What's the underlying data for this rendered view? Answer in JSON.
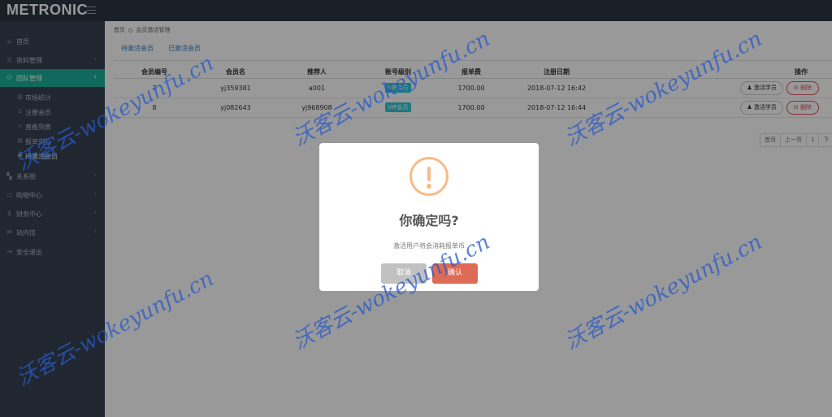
{
  "header": {
    "logo": "METRONIC"
  },
  "sidebar": {
    "items": [
      {
        "label": "首页",
        "icon": "home-icon"
      },
      {
        "label": "资料管理",
        "icon": "user-icon"
      },
      {
        "label": "团队管理",
        "icon": "team-icon",
        "active": true
      },
      {
        "label": "关系图",
        "icon": "sitemap-icon"
      },
      {
        "label": "购物中心",
        "icon": "cart-icon"
      },
      {
        "label": "财务中心",
        "icon": "dollar-icon"
      },
      {
        "label": "站内信",
        "icon": "mail-icon"
      },
      {
        "label": "安全退出",
        "icon": "logout-icon"
      }
    ],
    "subitems": [
      {
        "label": "市场统计",
        "icon": "chart-icon"
      },
      {
        "label": "注册会员",
        "icon": "user-add-icon"
      },
      {
        "label": "直推列表",
        "icon": "share-icon"
      },
      {
        "label": "报单中心",
        "icon": "doc-icon"
      },
      {
        "label": "待激活会员",
        "icon": "pin-icon",
        "current": true
      }
    ]
  },
  "breadcrumb": {
    "home": "首页",
    "current": "会员激活管理"
  },
  "tabs": [
    "待激活会员",
    "已激活会员"
  ],
  "table": {
    "headers": [
      "会员编号",
      "会员名",
      "推荐人",
      "账号级别",
      "报单费",
      "注册日期",
      "操作"
    ],
    "rows": [
      {
        "id": "7",
        "name": "yj359381",
        "referrer": "a001",
        "level": "VIP会员",
        "fee": "1700.00",
        "date": "2018-07-12 16:42"
      },
      {
        "id": "8",
        "name": "yj082643",
        "referrer": "yj968908",
        "level": "VIP会员",
        "fee": "1700.00",
        "date": "2018-07-12 16:44"
      }
    ],
    "activate_label": "激活学员",
    "delete_label": "删除"
  },
  "pager": [
    "首页",
    "上一页",
    "1",
    "下"
  ],
  "modal": {
    "title": "你确定吗?",
    "text": "激活用户将会消耗报单币",
    "cancel": "取消",
    "confirm": "确认"
  },
  "watermark": "沃客云-wokeyunfu.cn",
  "colors": {
    "header": "#2b3643",
    "sidebar": "#364150",
    "active": "#1caf9a",
    "badge": "#36c6d3",
    "warning": "#f8bb86",
    "confirm": "#dd6b55",
    "cancel": "#c1c1c1",
    "danger": "#e7505a"
  }
}
